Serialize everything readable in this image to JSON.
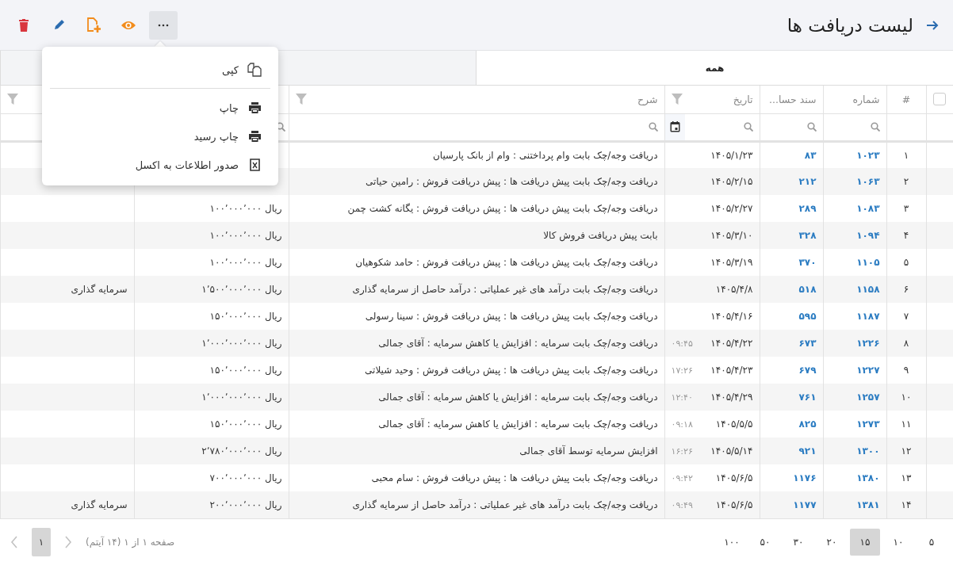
{
  "header": {
    "title": "لیست دریافت ها"
  },
  "toolbar": {
    "buttons": [
      {
        "kind": "delete",
        "selected": false
      },
      {
        "kind": "edit",
        "selected": false
      },
      {
        "kind": "add",
        "selected": false
      },
      {
        "kind": "view",
        "selected": false
      },
      {
        "kind": "more",
        "selected": true
      }
    ]
  },
  "menu": {
    "items": [
      {
        "kind": "copy",
        "label": "کپی"
      },
      {
        "kind": "divider"
      },
      {
        "kind": "print",
        "label": "چاپ"
      },
      {
        "kind": "print",
        "label": "چاپ رسید"
      },
      {
        "kind": "excel",
        "label": "صدور اطلاعات به اکسل"
      }
    ]
  },
  "tabs": [
    {
      "label": "همه",
      "selected": true
    }
  ],
  "table": {
    "select_all": {
      "checked": false
    },
    "columns": [
      {
        "kind": "index",
        "label": "#",
        "filter": false,
        "search": false
      },
      {
        "kind": "number",
        "label": "شماره",
        "filter": false,
        "search": true
      },
      {
        "kind": "doc",
        "label": "سند حسا...",
        "filter": false,
        "search": true
      },
      {
        "kind": "date",
        "label": "تاریخ",
        "filter": true,
        "search": true
      },
      {
        "kind": "description",
        "label": "شرح",
        "filter": true,
        "search": true
      },
      {
        "kind": "amount",
        "filter": false,
        "search": true
      },
      {
        "kind": "column_8",
        "filter": true,
        "search": false
      }
    ],
    "rows": [
      {
        "index": "۱",
        "number": "۱۰۲۳",
        "doc": "۸۳",
        "date": "۱۴۰۵/۱/۲۳",
        "description": "دریافت وجه/چک بابت وام پرداختنی : وام از بانک پارسیان"
      },
      {
        "index": "۲",
        "number": "۱۰۶۳",
        "doc": "۲۱۲",
        "date": "۱۴۰۵/۲/۱۵",
        "description": "دریافت وجه/چک بابت پیش دریافت ها : پیش دریافت فروش : رامین حیاتی"
      },
      {
        "index": "۳",
        "number": "۱۰۸۳",
        "doc": "۲۸۹",
        "date": "۱۴۰۵/۲/۲۷",
        "description": "دریافت وجه/چک بابت پیش دریافت ها : پیش دریافت فروش : یگانه کشت چمن",
        "amount": "ریال ۱۰۰٬۰۰۰٬۰۰۰"
      },
      {
        "index": "۴",
        "number": "۱۰۹۴",
        "doc": "۳۲۸",
        "date": "۱۴۰۵/۳/۱۰",
        "description": "بابت پیش دریافت فروش کالا",
        "amount": "ریال ۱۰۰٬۰۰۰٬۰۰۰"
      },
      {
        "index": "۵",
        "number": "۱۱۰۵",
        "doc": "۳۷۰",
        "date": "۱۴۰۵/۳/۱۹",
        "description": "دریافت وجه/چک بابت پیش دریافت ها : پیش دریافت فروش : حامد شکوهیان",
        "amount": "ریال ۱۰۰٬۰۰۰٬۰۰۰"
      },
      {
        "index": "۶",
        "number": "۱۱۵۸",
        "doc": "۵۱۸",
        "date": "۱۴۰۵/۴/۸",
        "description": "دریافت وجه/چک بابت درآمد های غیر عملیاتی : درآمد حاصل از سرمایه گذاری",
        "amount": "ریال ۱٬۵۰۰٬۰۰۰٬۰۰۰",
        "column_8": "سرمایه گذاری"
      },
      {
        "index": "۷",
        "number": "۱۱۸۷",
        "doc": "۵۹۵",
        "date": "۱۴۰۵/۴/۱۶",
        "description": "دریافت وجه/چک بابت پیش دریافت ها : پیش دریافت فروش : سینا رسولی",
        "amount": "ریال ۱۵۰٬۰۰۰٬۰۰۰"
      },
      {
        "index": "۸",
        "number": "۱۲۲۶",
        "doc": "۶۷۳",
        "date": "۱۴۰۵/۴/۲۲",
        "time": "۰۹:۴۵",
        "description": "دریافت وجه/چک بابت سرمایه : افزایش یا کاهش سرمایه : آقای جمالی",
        "amount": "ریال ۱٬۰۰۰٬۰۰۰٬۰۰۰"
      },
      {
        "index": "۹",
        "number": "۱۲۲۷",
        "doc": "۶۷۹",
        "date": "۱۴۰۵/۴/۲۳",
        "time": "۱۷:۲۶",
        "description": "دریافت وجه/چک بابت پیش دریافت ها : پیش دریافت فروش : وحید شیلاتی",
        "amount": "ریال ۱۵۰٬۰۰۰٬۰۰۰"
      },
      {
        "index": "۱۰",
        "number": "۱۲۵۷",
        "doc": "۷۶۱",
        "date": "۱۴۰۵/۴/۲۹",
        "time": "۱۲:۴۰",
        "description": "دریافت وجه/چک بابت سرمایه : افزایش یا کاهش سرمایه : آقای جمالی",
        "amount": "ریال ۱٬۰۰۰٬۰۰۰٬۰۰۰"
      },
      {
        "index": "۱۱",
        "number": "۱۲۷۳",
        "doc": "۸۲۵",
        "date": "۱۴۰۵/۵/۵",
        "time": "۰۹:۱۸",
        "description": "دریافت وجه/چک بابت سرمایه : افزایش یا کاهش سرمایه : آقای جمالی",
        "amount": "ریال ۱۵۰٬۰۰۰٬۰۰۰"
      },
      {
        "index": "۱۲",
        "number": "۱۳۰۰",
        "doc": "۹۲۱",
        "date": "۱۴۰۵/۵/۱۴",
        "time": "۱۶:۲۶",
        "description": "افزایش سرمایه توسط آقای جمالی",
        "amount": "ریال ۲٬۷۸۰٬۰۰۰٬۰۰۰"
      },
      {
        "index": "۱۳",
        "number": "۱۳۸۰",
        "doc": "۱۱۷۶",
        "date": "۱۴۰۵/۶/۵",
        "time": "۰۹:۴۲",
        "description": "دریافت وجه/چک بابت پیش دریافت ها : پیش دریافت فروش : سام محبی",
        "amount": "ریال ۷۰۰٬۰۰۰٬۰۰۰"
      },
      {
        "index": "۱۴",
        "number": "۱۳۸۱",
        "doc": "۱۱۷۷",
        "date": "۱۴۰۵/۶/۵",
        "time": "۰۹:۴۹",
        "description": "دریافت وجه/چک بابت درآمد های غیر عملیاتی : درآمد حاصل از سرمایه گذاری",
        "amount": "ریال ۲۰۰٬۰۰۰٬۰۰۰",
        "column_8": "سرمایه گذاری"
      }
    ]
  },
  "pager": {
    "page_sizes": [
      {
        "label": "۵",
        "selected": false
      },
      {
        "label": "۱۰",
        "selected": false
      },
      {
        "label": "۱۵",
        "selected": true
      },
      {
        "label": "۲۰",
        "selected": false
      },
      {
        "label": "۳۰",
        "selected": false
      },
      {
        "label": "۵۰",
        "selected": false
      },
      {
        "label": "۱۰۰",
        "selected": false
      }
    ],
    "summary": "صفحه ۱ از ۱ (۱۴ آیتم)",
    "previous": {
      "disabled": true
    },
    "pages": [
      {
        "label": "۱",
        "selected": true
      }
    ],
    "next": {
      "disabled": true
    }
  }
}
